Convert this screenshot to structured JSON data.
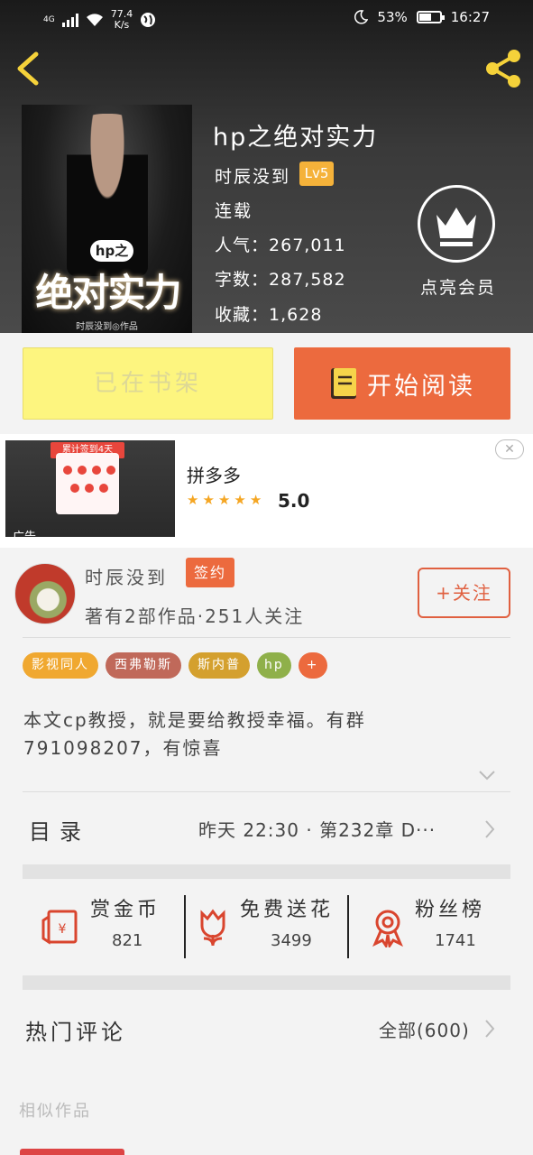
{
  "status_bar": {
    "network": "4G",
    "speed_value": "77.4",
    "speed_unit": "K/s",
    "battery": "53%",
    "time": "16:27"
  },
  "book": {
    "title": "hp之绝对实力",
    "author": "时辰没到",
    "level": "Lv5",
    "status": "连载",
    "popularity_label": "人气：",
    "popularity": "267,011",
    "words_label": "字数：",
    "words": "287,582",
    "collect_label": "收藏：",
    "collect": "1,628",
    "cover_hp": "hp之",
    "cover_title": "绝对实力",
    "cover_author": "时辰没到◎作品"
  },
  "vip": {
    "label": "点亮会员"
  },
  "buttons": {
    "shelf": "已在书架",
    "read": "开始阅读"
  },
  "ad": {
    "name": "拼多多",
    "rating": "5.0",
    "stars": 5,
    "tag": "广告",
    "banner": "累计签到4天",
    "close": "✕"
  },
  "author_card": {
    "name": "时辰没到",
    "sign": "签约",
    "meta": "著有2部作品·251人关注",
    "follow": "+关注"
  },
  "tags": [
    {
      "label": "影视同人",
      "color": "#f0a830"
    },
    {
      "label": "西弗勒斯",
      "color": "#c0695a"
    },
    {
      "label": "斯内普",
      "color": "#d4a02e"
    },
    {
      "label": "hp",
      "color": "#8fb04a"
    },
    {
      "label": "+",
      "color": "#ec6a3e"
    }
  ],
  "description": "本文cp教授，就是要给教授幸福。有群791098207，有惊喜",
  "toc": {
    "label": "目录",
    "latest": "昨天 22:30 · 第232章 D···"
  },
  "actions": [
    {
      "title": "赏金币",
      "count": "821",
      "icon": "red-envelope-icon"
    },
    {
      "title": "免费送花",
      "count": "3499",
      "icon": "flower-icon"
    },
    {
      "title": "粉丝榜",
      "count": "1741",
      "icon": "medal-icon"
    }
  ],
  "hot_comments": {
    "label": "热门评论",
    "all": "全部(600)"
  },
  "similar": {
    "label": "相似作品"
  }
}
